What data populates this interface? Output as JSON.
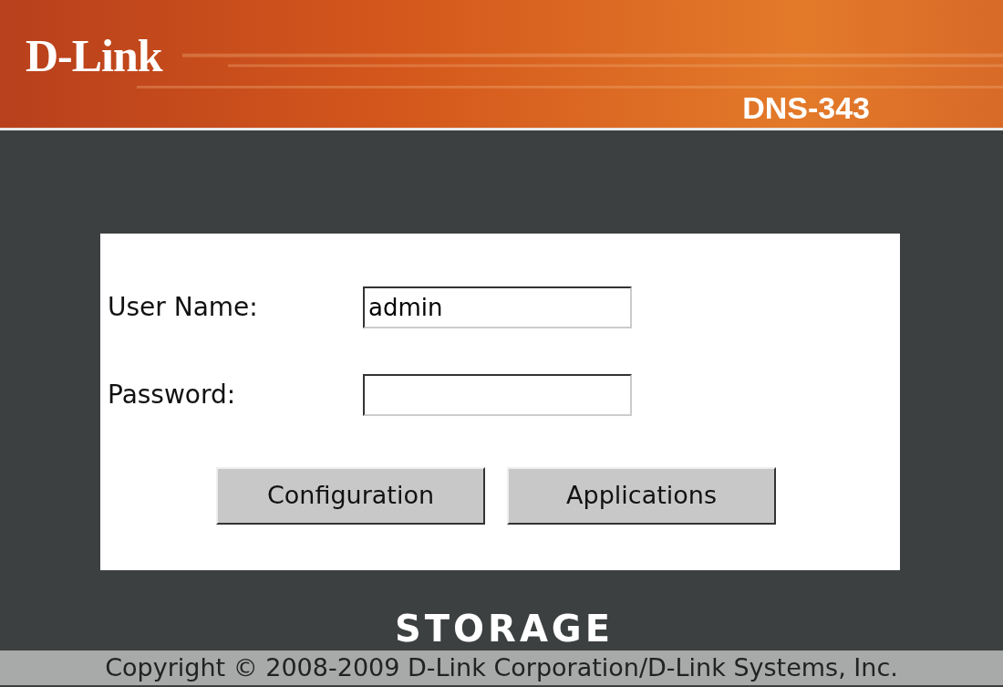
{
  "header": {
    "logo": "D-Link",
    "model": "DNS-343"
  },
  "login": {
    "fields": [
      {
        "label": "User Name:",
        "value": "admin",
        "kind": "text"
      },
      {
        "label": "Password:",
        "kind": "password"
      }
    ],
    "buttons": [
      "Configuration",
      "Applications"
    ]
  },
  "brand": "STORAGE",
  "footer": {
    "copyright": "Copyright © 2008-2009 D-Link Corporation/D-Link Systems, Inc."
  }
}
